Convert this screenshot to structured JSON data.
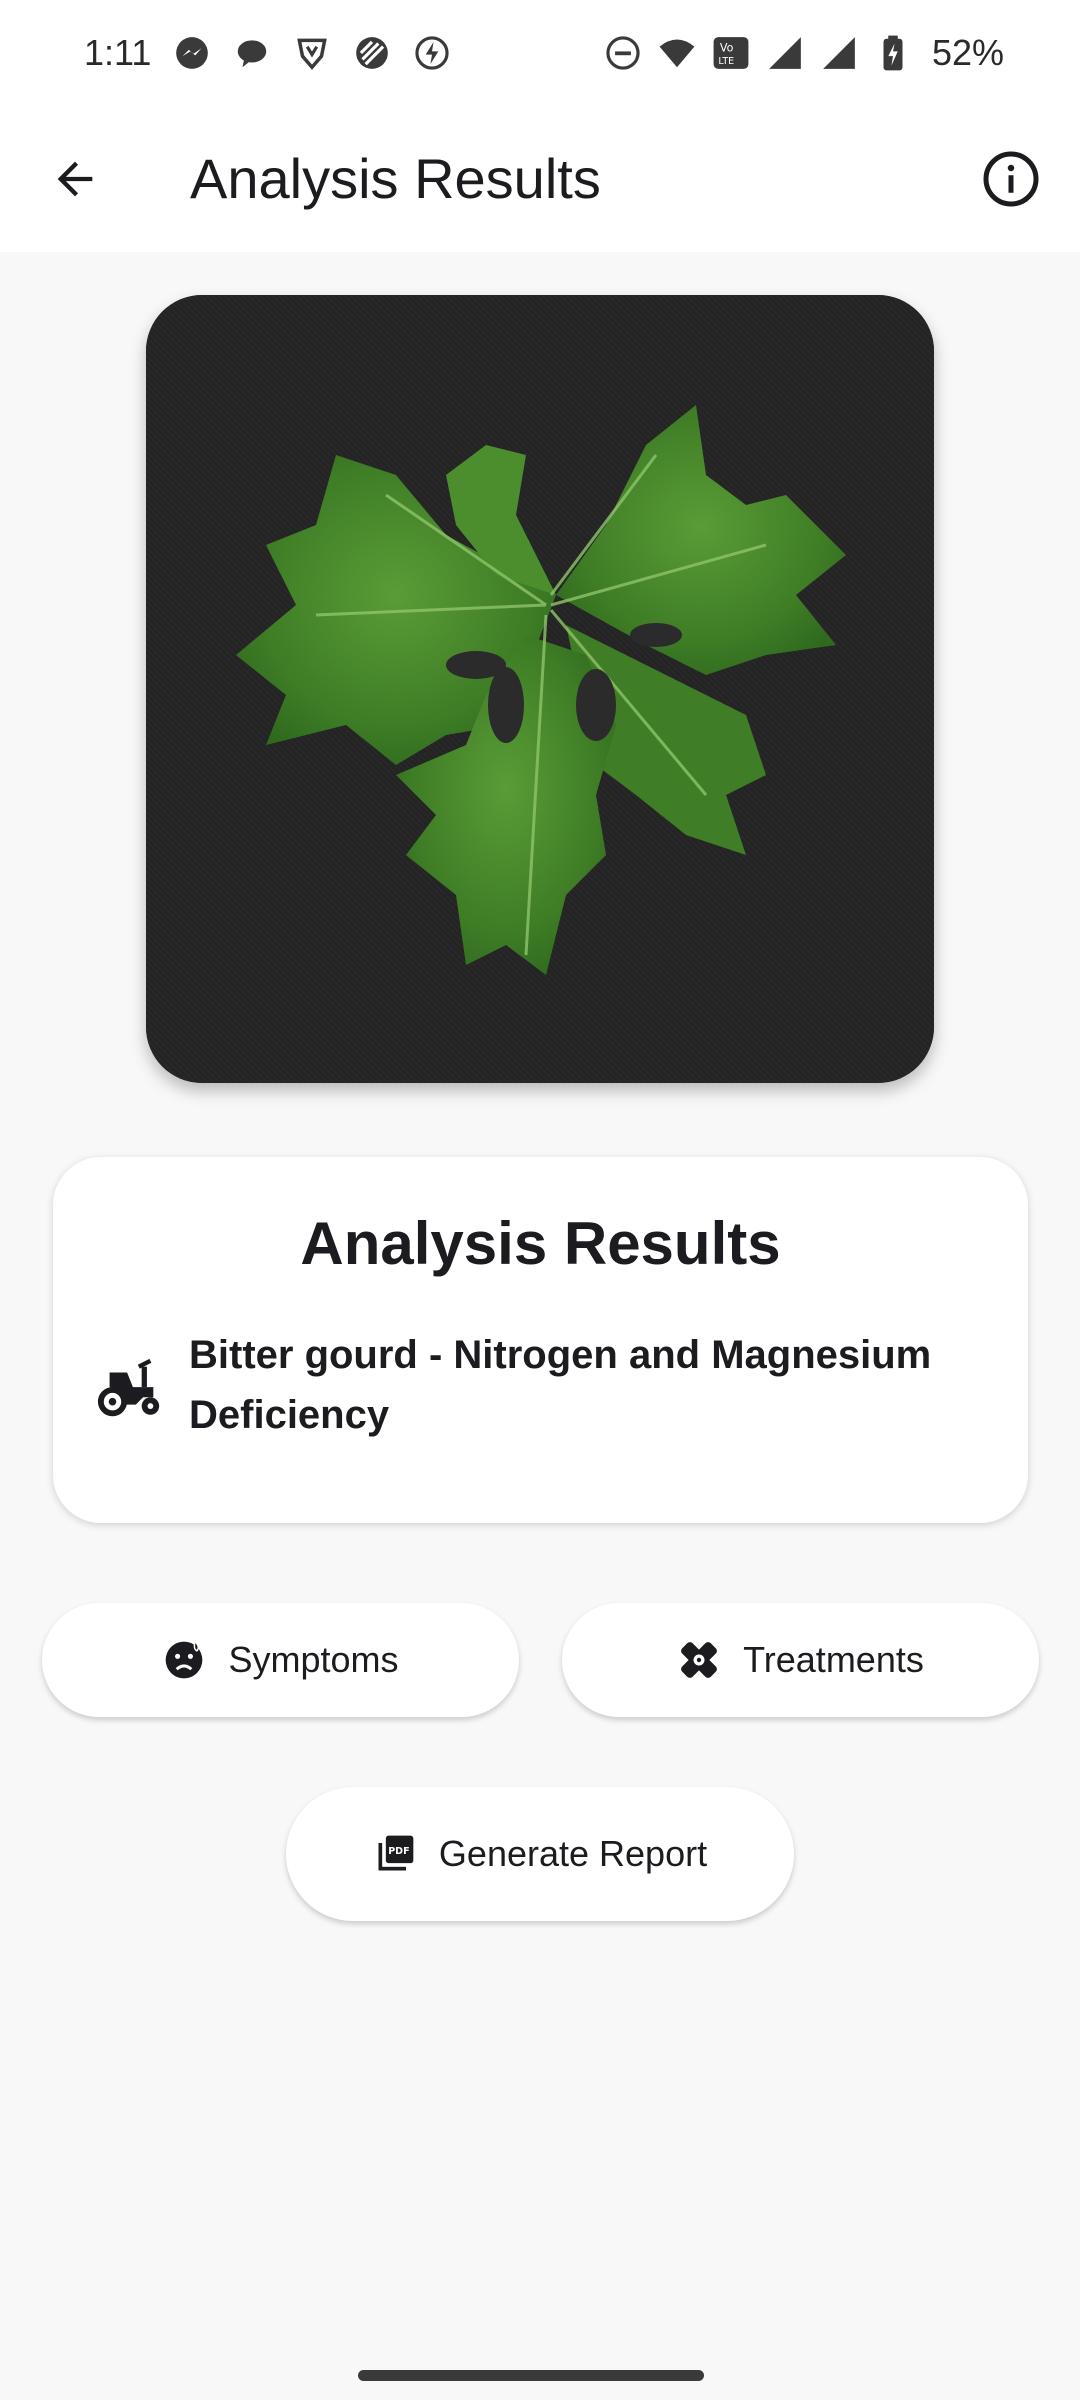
{
  "status_bar": {
    "time": "1:11",
    "battery_percent": "52%",
    "left_icons": [
      "messenger-icon",
      "chat-bubble-icon",
      "brave-icon",
      "striped-app-icon",
      "bolt-icon"
    ],
    "right_icons": [
      "do-not-disturb-icon",
      "wifi-icon",
      "volte-icon",
      "signal-icon",
      "signal-icon",
      "battery-charging-icon"
    ]
  },
  "app_bar": {
    "title": "Analysis Results",
    "back_icon": "arrow-back-icon",
    "info_icon": "info-icon"
  },
  "image": {
    "subject": "leaf-photo"
  },
  "results": {
    "title": "Analysis Results",
    "icon": "tractor-icon",
    "diagnosis": "Bitter gourd - Nitrogen and Magnesium Deficiency"
  },
  "actions": {
    "symptoms_label": "Symptoms",
    "symptoms_icon": "sick-face-icon",
    "treatments_label": "Treatments",
    "treatments_icon": "healing-icon",
    "report_label": "Generate Report",
    "report_icon": "pdf-icon"
  },
  "colors": {
    "background": "#f8f8f8",
    "surface": "#ffffff",
    "text": "#1c1b1f",
    "leaf_green": "#4f8f2f",
    "image_background": "#2b2b2b"
  }
}
